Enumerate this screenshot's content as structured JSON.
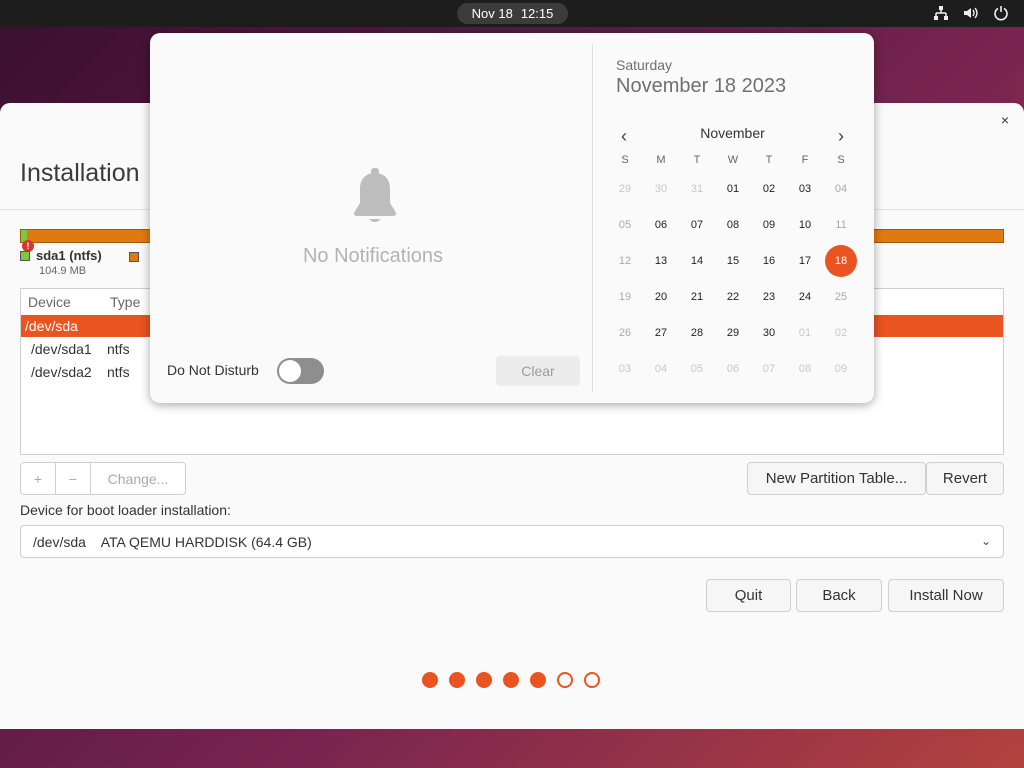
{
  "topbar": {
    "date": "Nov 18",
    "time": "12:15",
    "tray_icons": [
      "network-icon",
      "volume-icon",
      "power-icon"
    ]
  },
  "installer": {
    "title": "Installation",
    "close": "×",
    "partition_legend": {
      "label": "sda1 (ntfs)",
      "size": "104.9 MB",
      "color": "#7bc843"
    },
    "table": {
      "headers": [
        "Device",
        "Type"
      ],
      "rows": [
        {
          "device": "/dev/sda",
          "type": ""
        },
        {
          "device": "/dev/sda1",
          "type": "ntfs"
        },
        {
          "device": "/dev/sda2",
          "type": "ntfs"
        }
      ]
    },
    "toolbar": {
      "add": "+",
      "remove": "−",
      "change": "Change..."
    },
    "new_partition_table": "New Partition Table...",
    "revert": "Revert",
    "boot_loader_label": "Device for boot loader installation:",
    "boot_device": "/dev/sda    ATA QEMU HARDDISK (64.4 GB)",
    "quit": "Quit",
    "back": "Back",
    "install_now": "Install Now",
    "progress": {
      "total": 7,
      "completed": 5
    },
    "accent_color": "#e95420"
  },
  "notifications": {
    "empty_text": "No Notifications",
    "dnd_label": "Do Not Disturb",
    "dnd_on": false,
    "clear_label": "Clear"
  },
  "calendar": {
    "weekday": "Saturday",
    "date": "November 18 2023",
    "month": "November",
    "weekday_headers": [
      "S",
      "M",
      "T",
      "W",
      "T",
      "F",
      "S"
    ],
    "weeks": [
      [
        "29",
        "30",
        "31",
        "01",
        "02",
        "03",
        "04"
      ],
      [
        "05",
        "06",
        "07",
        "08",
        "09",
        "10",
        "11"
      ],
      [
        "12",
        "13",
        "14",
        "15",
        "16",
        "17",
        "18"
      ],
      [
        "19",
        "20",
        "21",
        "22",
        "23",
        "24",
        "25"
      ],
      [
        "26",
        "27",
        "28",
        "29",
        "30",
        "01",
        "02"
      ],
      [
        "03",
        "04",
        "05",
        "06",
        "07",
        "08",
        "09"
      ]
    ],
    "today": "18"
  }
}
